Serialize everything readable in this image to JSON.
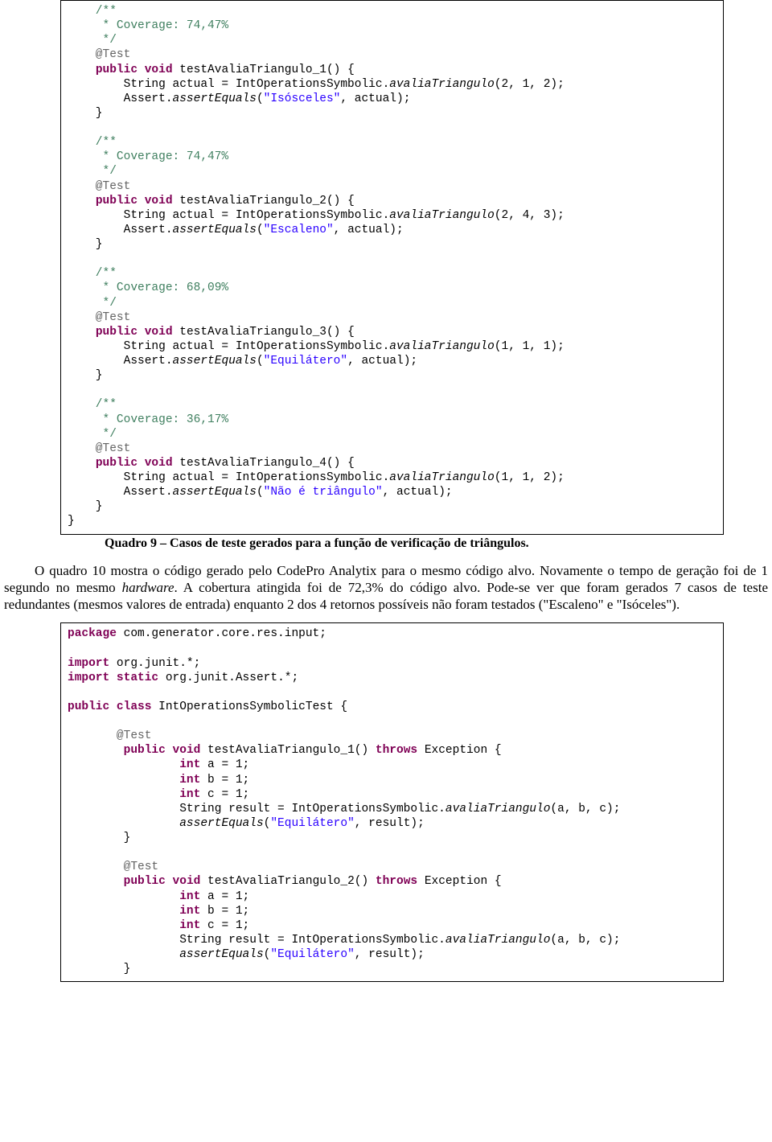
{
  "code1": {
    "c1": "    /**",
    "c2": "     * Coverage: 74,47%",
    "c3": "     */",
    "an1": "    @Test",
    "sig1a": "public",
    "sig1b": "void",
    "sig1c": " testAvaliaTriangulo_1() {",
    "l1a": "        String actual = IntOperationsSymbolic.",
    "l1m": "avaliaTriangulo",
    "l1b": "(2, 1, 2);",
    "l2a": "        Assert.",
    "l2m": "assertEquals",
    "l2b": "(",
    "l2s": "\"Isósceles\"",
    "l2c": ", actual);",
    "close1": "    }",
    "c4": "    /**",
    "c5": "     * Coverage: 74,47%",
    "c6": "     */",
    "an2": "    @Test",
    "sig2a": "public",
    "sig2b": "void",
    "sig2c": " testAvaliaTriangulo_2() {",
    "l3a": "        String actual = IntOperationsSymbolic.",
    "l3m": "avaliaTriangulo",
    "l3b": "(2, 4, 3);",
    "l4a": "        Assert.",
    "l4m": "assertEquals",
    "l4b": "(",
    "l4s": "\"Escaleno\"",
    "l4c": ", actual);",
    "close2": "    }",
    "c7": "    /**",
    "c8": "     * Coverage: 68,09%",
    "c9": "     */",
    "an3": "    @Test",
    "sig3a": "public",
    "sig3b": "void",
    "sig3c": " testAvaliaTriangulo_3() {",
    "l5a": "        String actual = IntOperationsSymbolic.",
    "l5m": "avaliaTriangulo",
    "l5b": "(1, 1, 1);",
    "l6a": "        Assert.",
    "l6m": "assertEquals",
    "l6b": "(",
    "l6s": "\"Equilátero\"",
    "l6c": ", actual);",
    "close3": "    }",
    "c10": "    /**",
    "c11": "     * Coverage: 36,17%",
    "c12": "     */",
    "an4": "    @Test",
    "sig4a": "public",
    "sig4b": "void",
    "sig4c": " testAvaliaTriangulo_4() {",
    "l7a": "        String actual = IntOperationsSymbolic.",
    "l7m": "avaliaTriangulo",
    "l7b": "(1, 1, 2);",
    "l8a": "        Assert.",
    "l8m": "assertEquals",
    "l8b": "(",
    "l8s": "\"Não é triângulo\"",
    "l8c": ", actual);",
    "close4": "    }",
    "classclose": "}"
  },
  "caption": "Quadro 9 – Casos de teste gerados para a função de verificação de triângulos.",
  "para": {
    "p1a": "O quadro 10 mostra o código gerado pelo CodePro Analytix para o mesmo código alvo. Novamente o tempo de geração foi de 1 segundo no mesmo ",
    "p1i": "hardware",
    "p1b": ". A cobertura atingida foi de 72,3% do código alvo. Pode-se ver que foram gerados 7 casos de teste redundantes (mesmos valores de entrada) enquanto 2 dos 4 retornos possíveis não foram testados (\"Escaleno\" e \"Isóceles\")."
  },
  "code2": {
    "pkg1": "package",
    "pkg2": " com.generator.core.res.input;",
    "imp1a": "import",
    "imp1b": " org.junit.*;",
    "imp2a": "import",
    "imp2b": "static",
    "imp2c": " org.junit.Assert.*;",
    "cls1": "public",
    "cls2": "class",
    "cls3": " IntOperationsSymbolicTest {",
    "an1": "       @Test",
    "sig1a": "public",
    "sig1b": "void",
    "sig1c": " testAvaliaTriangulo_1() ",
    "sig1d": "throws",
    "sig1e": " Exception {",
    "v1a": "int",
    "v1b": " a = 1;",
    "v2a": "int",
    "v2b": " b = 1;",
    "v3a": "int",
    "v3b": " c = 1;",
    "r1a": "                String result = IntOperationsSymbolic.",
    "r1m": "avaliaTriangulo",
    "r1b": "(a, b, c);",
    "a1a": "                ",
    "a1m": "assertEquals",
    "a1b": "(",
    "a1s": "\"Equilátero\"",
    "a1c": ", result);",
    "close1": "        }",
    "an2": "        @Test",
    "sig2a": "public",
    "sig2b": "void",
    "sig2c": " testAvaliaTriangulo_2() ",
    "sig2d": "throws",
    "sig2e": " Exception {",
    "v4a": "int",
    "v4b": " a = 1;",
    "v5a": "int",
    "v5b": " b = 1;",
    "v6a": "int",
    "v6b": " c = 1;",
    "r2a": "                String result = IntOperationsSymbolic.",
    "r2m": "avaliaTriangulo",
    "r2b": "(a, b, c);",
    "a2a": "                ",
    "a2m": "assertEquals",
    "a2b": "(",
    "a2s": "\"Equilátero\"",
    "a2c": ", result);",
    "close2": "        }"
  }
}
